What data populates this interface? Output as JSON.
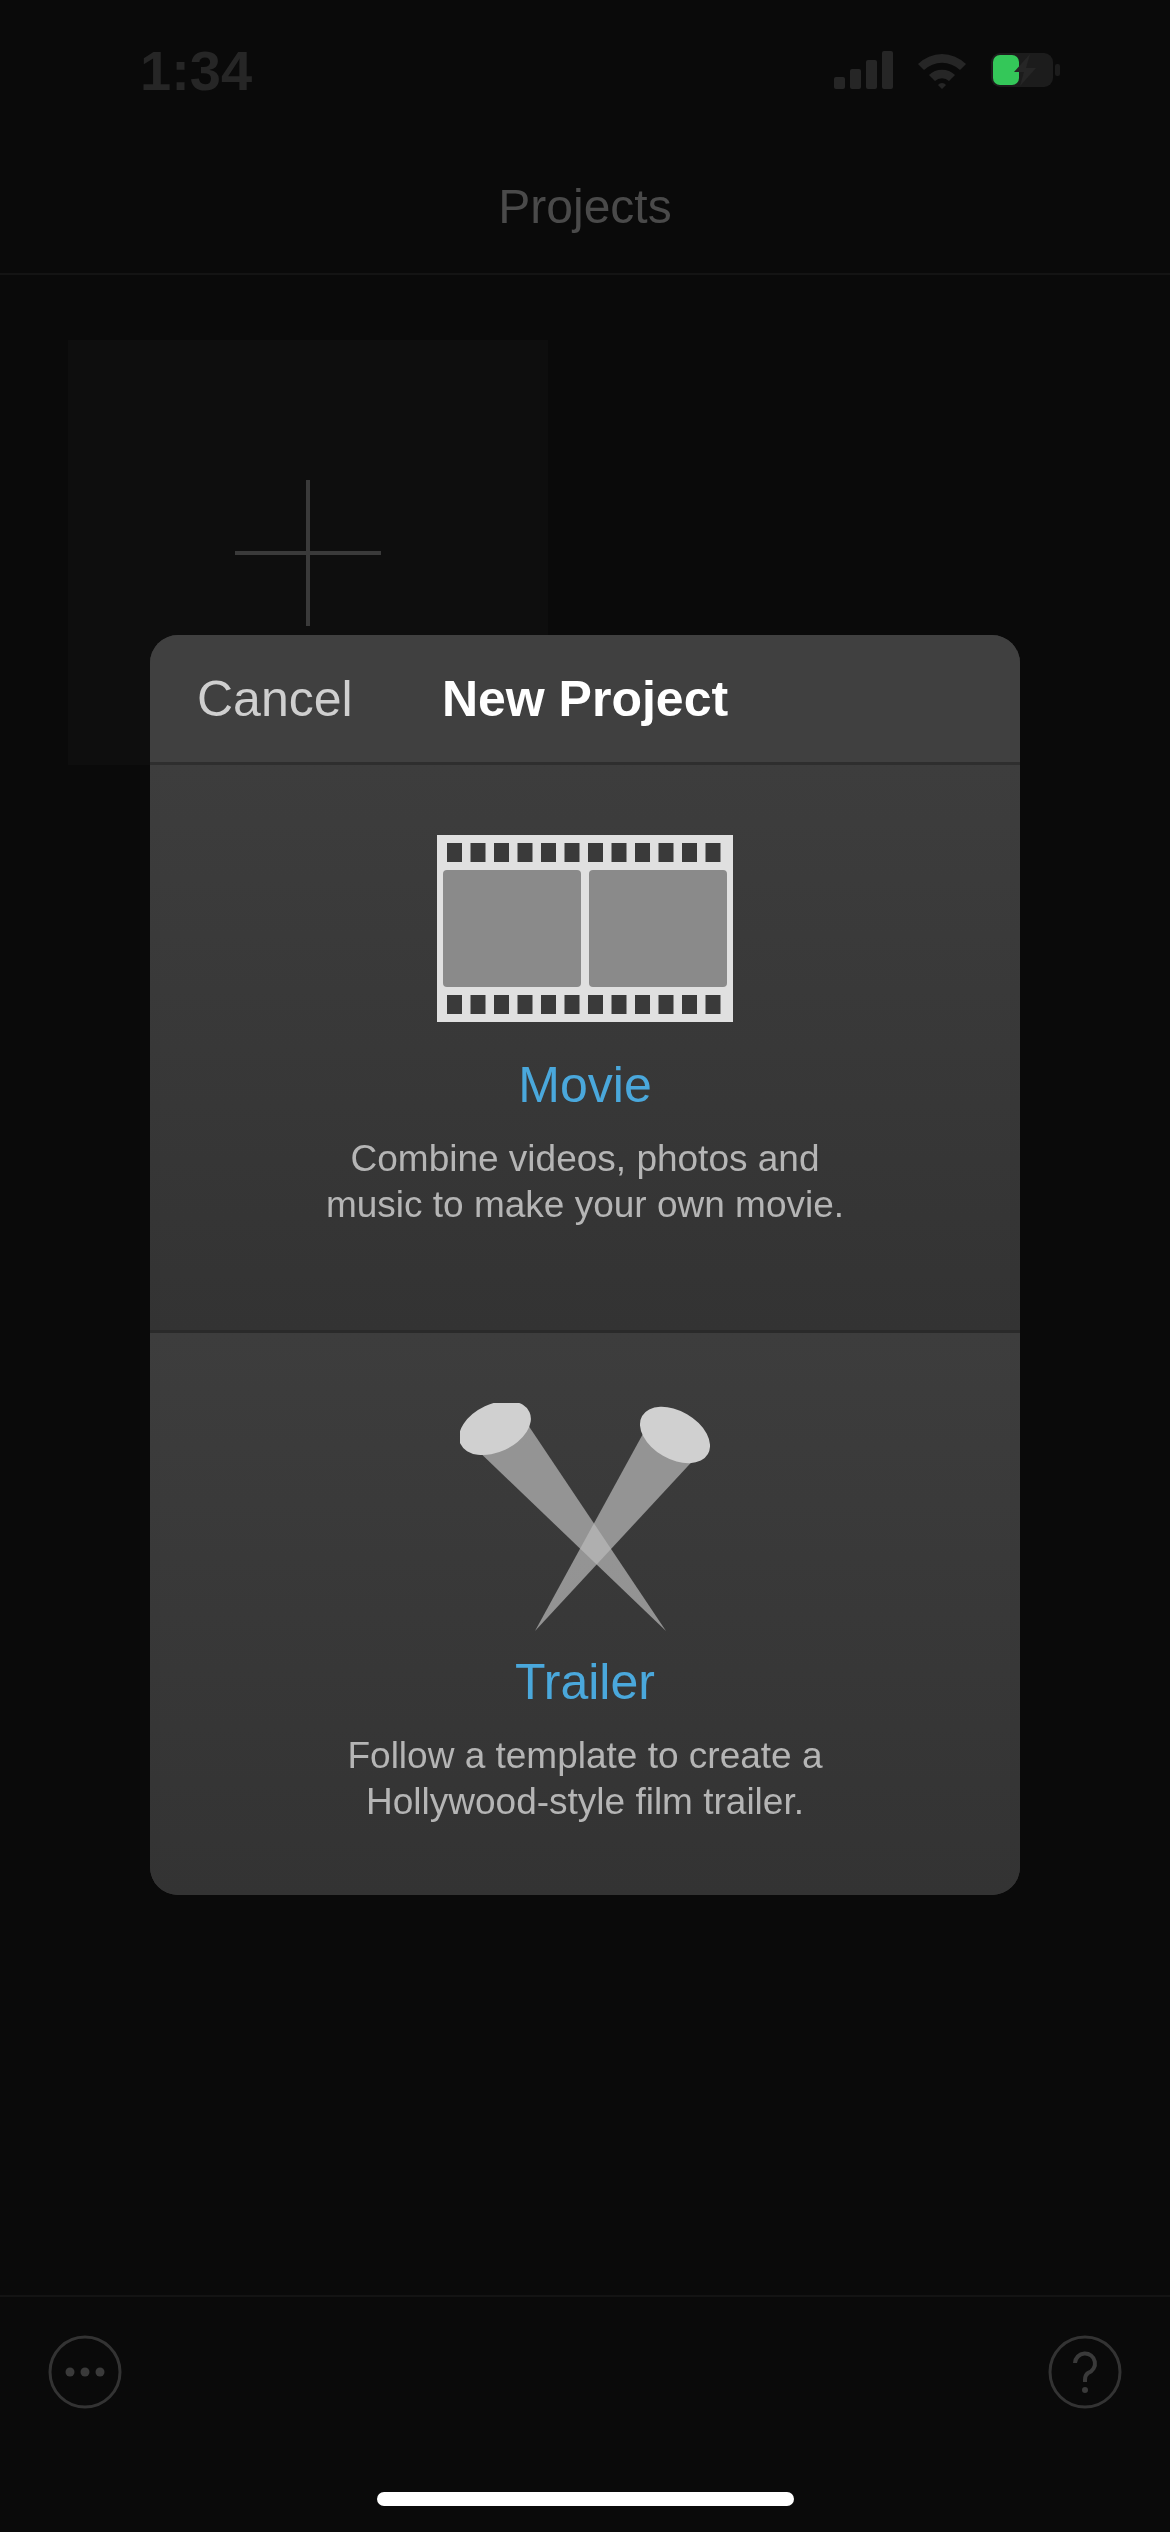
{
  "status_bar": {
    "time": "1:34"
  },
  "header": {
    "title": "Projects"
  },
  "dialog": {
    "cancel": "Cancel",
    "title": "New Project",
    "options": [
      {
        "kind": "movie",
        "label": "Movie",
        "description": "Combine videos, photos and\nmusic to make your own movie."
      },
      {
        "kind": "trailer",
        "label": "Trailer",
        "description": "Follow a template to create a\nHollywood-style film trailer."
      }
    ]
  }
}
